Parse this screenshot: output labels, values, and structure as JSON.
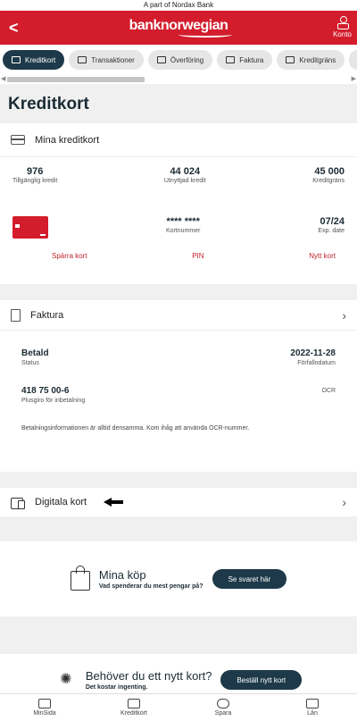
{
  "topbar": {
    "text": "A part of Nordax Bank"
  },
  "header": {
    "back_glyph": "<",
    "logo": "banknorwegian",
    "account_label": "Konto",
    "color": "#d31c2c"
  },
  "tabs": [
    {
      "label": "Kreditkort",
      "active": true
    },
    {
      "label": "Transaktioner",
      "active": false
    },
    {
      "label": "Överföring",
      "active": false
    },
    {
      "label": "Faktura",
      "active": false
    },
    {
      "label": "Kreditgräns",
      "active": false
    }
  ],
  "page": {
    "title": "Kreditkort"
  },
  "cards_section": {
    "title": "Mina kreditkort",
    "available": {
      "value": "976",
      "label": "Tillgänglig kredit"
    },
    "used": {
      "value": "44 024",
      "label": "Utnyttjad kredit"
    },
    "limit": {
      "value": "45 000",
      "label": "Kreditgräns"
    },
    "card_number": {
      "value": "**** ****",
      "label": "Kortnummer"
    },
    "expiry": {
      "value": "07/24",
      "label": "Exp. date"
    },
    "actions": {
      "block": "Spärra kort",
      "pin": "PIN",
      "new": "Nytt kort"
    }
  },
  "invoice_section": {
    "title": "Faktura",
    "status": {
      "value": "Betald",
      "label": "Status"
    },
    "due": {
      "value": "2022-11-28",
      "label": "Förfallodatum"
    },
    "account": {
      "value": "418 75 00-6",
      "label": "Plusgiro för inbetalning"
    },
    "ocr_label": "OCR",
    "note": "Betalningsinformationen är alltid densamma. Kom ihåg att använda OCR-nummer."
  },
  "digital_section": {
    "title": "Digitala kort"
  },
  "promo_purchases": {
    "title": "Mina köp",
    "subtitle": "Vad spenderar du mest pengar på?",
    "button": "Se svaret här"
  },
  "promo_newcard": {
    "title": "Behöver du ett nytt kort?",
    "subtitle": "Det kostar ingenting.",
    "button": "Beställ nytt kort"
  },
  "bottom_nav": [
    {
      "label": "MinSida"
    },
    {
      "label": "Kreditkort"
    },
    {
      "label": "Spara"
    },
    {
      "label": "Lån"
    }
  ]
}
